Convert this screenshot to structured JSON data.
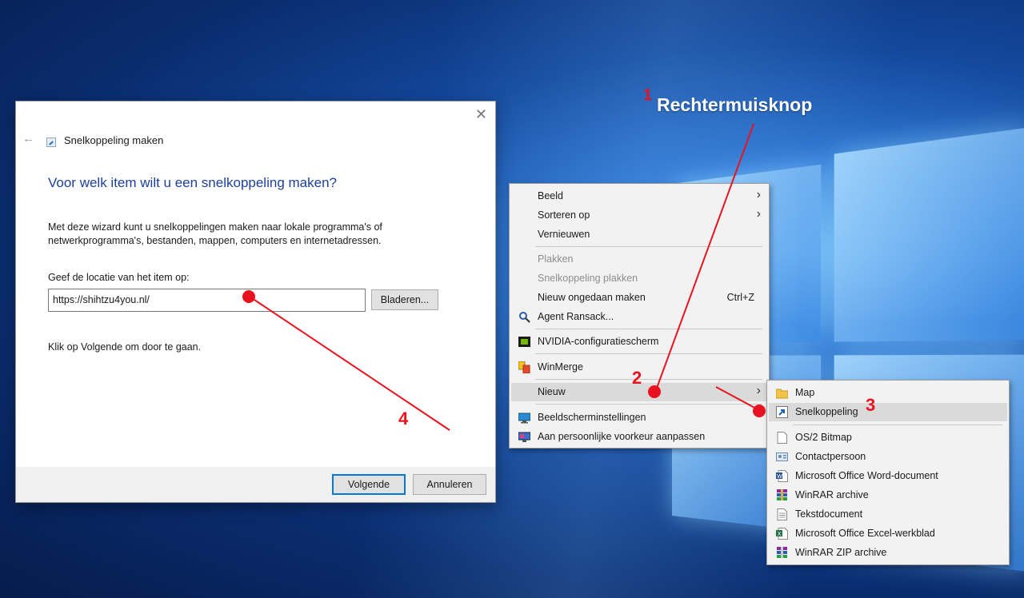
{
  "dialog": {
    "title": "Snelkoppeling maken",
    "close_glyph": "✕",
    "back_glyph": "←",
    "heading": "Voor welk item wilt u een snelkoppeling maken?",
    "description": "Met deze wizard kunt u snelkoppelingen maken naar lokale programma's of netwerkprogramma's, bestanden, mappen, computers en internetadressen.",
    "location_label": "Geef de locatie van het item op:",
    "location_value": "https://shihtzu4you.nl/",
    "browse_label": "Bladeren...",
    "hint": "Klik op Volgende om door te gaan.",
    "next_label": "Volgende",
    "cancel_label": "Annuleren"
  },
  "context_menu": {
    "items": [
      {
        "label": "Beeld",
        "submenu": true
      },
      {
        "label": "Sorteren op",
        "submenu": true
      },
      {
        "label": "Vernieuwen"
      },
      {
        "label": "Plakken",
        "disabled": true
      },
      {
        "label": "Snelkoppeling plakken",
        "disabled": true
      },
      {
        "label": "Nieuw ongedaan maken",
        "shortcut": "Ctrl+Z"
      },
      {
        "label": "Agent Ransack...",
        "icon": "agent-ransack-icon"
      },
      {
        "label": "NVIDIA-configuratiescherm",
        "icon": "nvidia-icon"
      },
      {
        "label": "WinMerge",
        "icon": "winmerge-icon"
      },
      {
        "label": "Nieuw",
        "submenu": true,
        "highlighted": true
      },
      {
        "label": "Beeldscherminstellingen",
        "icon": "display-settings-icon"
      },
      {
        "label": "Aan persoonlijke voorkeur aanpassen",
        "icon": "personalize-icon"
      }
    ]
  },
  "new_submenu": {
    "items": [
      {
        "label": "Map",
        "icon": "folder-icon"
      },
      {
        "label": "Snelkoppeling",
        "icon": "shortcut-icon",
        "highlighted": true
      },
      {
        "label": "OS/2 Bitmap",
        "icon": "bitmap-icon"
      },
      {
        "label": "Contactpersoon",
        "icon": "contact-icon"
      },
      {
        "label": "Microsoft Office Word-document",
        "icon": "word-icon"
      },
      {
        "label": "WinRAR archive",
        "icon": "winrar-icon"
      },
      {
        "label": "Tekstdocument",
        "icon": "text-document-icon"
      },
      {
        "label": "Microsoft Office Excel-werkblad",
        "icon": "excel-icon"
      },
      {
        "label": "WinRAR ZIP archive",
        "icon": "winrar-zip-icon"
      }
    ]
  },
  "annotations": {
    "title": "Rechtermuisknop",
    "step1": "1",
    "step2": "2",
    "step3": "3",
    "step4": "4",
    "color": "#e8131e"
  },
  "submenu_arrow": "›"
}
